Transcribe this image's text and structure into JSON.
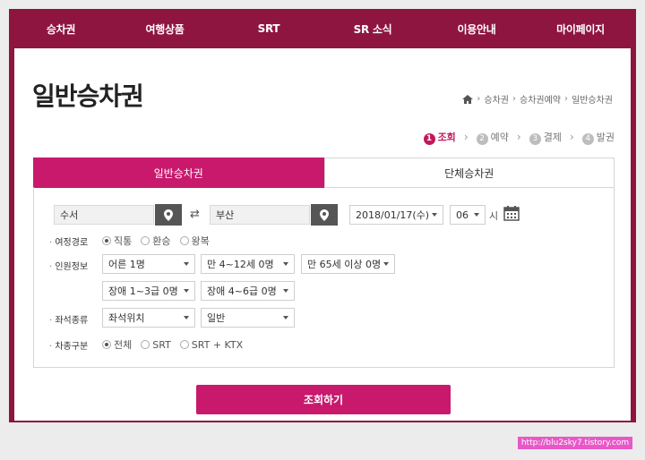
{
  "nav": {
    "items": [
      "승차권",
      "여행상품",
      "SRT",
      "SR 소식",
      "이용안내",
      "마이페이지"
    ]
  },
  "page": {
    "title": "일반승차권",
    "breadcrumb": [
      "승차권",
      "승차권예약",
      "일반승차권"
    ]
  },
  "steps": [
    {
      "num": "1",
      "label": "조회",
      "active": true
    },
    {
      "num": "2",
      "label": "예약",
      "active": false
    },
    {
      "num": "3",
      "label": "결제",
      "active": false
    },
    {
      "num": "4",
      "label": "발권",
      "active": false
    }
  ],
  "tabs": [
    "일반승차권",
    "단체승차권"
  ],
  "form": {
    "departure": "수서",
    "arrival": "부산",
    "date": "2018/01/17(수)",
    "hour": "06",
    "hour_unit": "시",
    "route": {
      "label": "여정경로",
      "options": [
        "직통",
        "환승",
        "왕복"
      ],
      "selected": "직통"
    },
    "passengers": {
      "label": "인원정보",
      "adult": "어른 1명",
      "child": "만 4~12세 0명",
      "senior": "만 65세 이상 0명",
      "disabled_1_3": "장애 1~3급 0명",
      "disabled_4_6": "장애 4~6급 0명"
    },
    "seat": {
      "label": "좌석종류",
      "position": "좌석위치",
      "class": "일반"
    },
    "train": {
      "label": "차종구분",
      "options": [
        "전체",
        "SRT",
        "SRT + KTX"
      ],
      "selected": "전체"
    },
    "submit_label": "조회하기"
  },
  "watermark": "http://blu2sky7.tistory.com",
  "colors": {
    "nav_bg": "#8e1540",
    "accent": "#c8196d",
    "pin_button": "#555555"
  }
}
